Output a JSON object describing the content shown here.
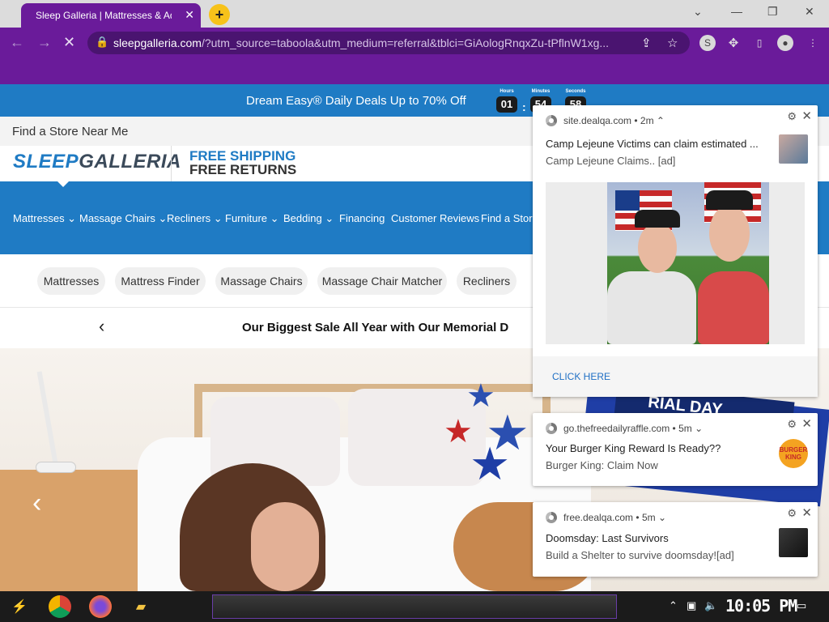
{
  "browser": {
    "tab_title": "Sleep Galleria | Mattresses & Adjustable Beds",
    "tab_close": "✕",
    "new_tab": "+",
    "url_host": "sleepgalleria.com",
    "url_path": "/?utm_source=taboola&utm_medium=referral&tblci=GiAologRnqxZu-tPflnW1xg...",
    "window_controls": [
      "⌄",
      "—",
      "❐",
      "✕"
    ]
  },
  "promo": {
    "text": "Dream Easy® Daily Deals Up to 70% Off",
    "countdown": [
      {
        "label": "Hours",
        "value": "01"
      },
      {
        "label": "Minutes",
        "value": "54"
      },
      {
        "label": "Seconds",
        "value": "58"
      }
    ]
  },
  "store_link": "Find a Store Near Me",
  "logo": {
    "brand_a": "SLEEP",
    "brand_b": "GALLERIA"
  },
  "shipping": {
    "line1": "FREE SHIPPING",
    "line2": "FREE RETURNS"
  },
  "nav": [
    "Mattresses ⌄",
    "Massage Chairs ⌄",
    "Recliners ⌄",
    "Furniture ⌄",
    "Bedding ⌄",
    "Financing",
    "Customer Reviews",
    "Find a Store"
  ],
  "pills": [
    "Mattresses",
    "Mattress Finder",
    "Massage Chairs",
    "Massage Chair Matcher",
    "Recliners"
  ],
  "sale_text": "Our Biggest Sale All Year with Our Memorial D",
  "hero_banner": "RIAL DAY",
  "notifications": [
    {
      "source": "site.dealqa.com",
      "time": "• 2m ⌃",
      "title": "Camp Lejeune Victims can claim estimated ...",
      "body": "Camp Lejeune Claims.. [ad]",
      "cta": "CLICK HERE"
    },
    {
      "source": "go.thefreedailyraffle.com",
      "time": "• 5m ⌄",
      "title": " Your Burger King Reward Is Ready??",
      "body": "Burger King:  Claim Now",
      "thumb_text": "BURGER KING"
    },
    {
      "source": "free.dealqa.com",
      "time": "• 5m ⌄",
      "title": "Doomsday: Last Survivors",
      "body": "Build a Shelter to survive doomsday![ad]"
    }
  ],
  "taskbar": {
    "clock": "10:05 PM"
  },
  "colors": {
    "purple": "#6a1b9a",
    "blue": "#1f7bc4",
    "link": "#1f6fc4"
  }
}
